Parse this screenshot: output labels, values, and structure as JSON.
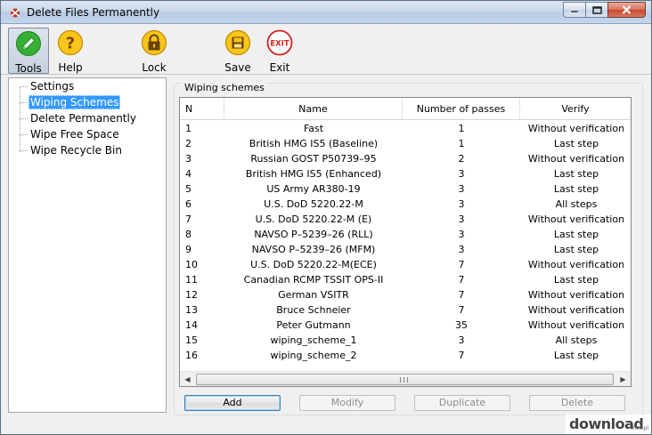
{
  "window": {
    "title": "Delete Files Permanently"
  },
  "toolbar": {
    "tools_label": "Tools",
    "help_label": "Help",
    "lock_label": "Lock",
    "save_label": "Save",
    "exit_label": "Exit",
    "exit_icon_text": "EXIT"
  },
  "sidebar": {
    "items": [
      {
        "label": "Settings"
      },
      {
        "label": "Wiping Schemes",
        "selected": true
      },
      {
        "label": "Delete Permanently"
      },
      {
        "label": "Wipe Free Space"
      },
      {
        "label": "Wipe Recycle Bin"
      }
    ]
  },
  "schemes": {
    "group_title": "Wiping schemes",
    "columns": [
      "N",
      "Name",
      "Number of passes",
      "Verify"
    ],
    "rows": [
      {
        "n": "1",
        "name": "Fast",
        "passes": "1",
        "verify": "Without verification"
      },
      {
        "n": "2",
        "name": "British HMG IS5 (Baseline)",
        "passes": "1",
        "verify": "Last step"
      },
      {
        "n": "3",
        "name": "Russian GOST P50739–95",
        "passes": "2",
        "verify": "Without verification"
      },
      {
        "n": "4",
        "name": "British HMG IS5 (Enhanced)",
        "passes": "3",
        "verify": "Last step"
      },
      {
        "n": "5",
        "name": "US Army AR380-19",
        "passes": "3",
        "verify": "Last step"
      },
      {
        "n": "6",
        "name": "U.S. DoD 5220.22-M",
        "passes": "3",
        "verify": "All steps"
      },
      {
        "n": "7",
        "name": "U.S. DoD 5220.22-M (E)",
        "passes": "3",
        "verify": "Without verification"
      },
      {
        "n": "8",
        "name": "NAVSO P–5239–26 (RLL)",
        "passes": "3",
        "verify": "Last step"
      },
      {
        "n": "9",
        "name": "NAVSO P–5239–26 (MFM)",
        "passes": "3",
        "verify": "Last step"
      },
      {
        "n": "10",
        "name": "U.S. DoD 5220.22-M(ECE)",
        "passes": "7",
        "verify": "Without verification"
      },
      {
        "n": "11",
        "name": "Canadian RCMP TSSIT OPS-II",
        "passes": "7",
        "verify": "Last step"
      },
      {
        "n": "12",
        "name": "German VSITR",
        "passes": "7",
        "verify": "Without verification"
      },
      {
        "n": "13",
        "name": "Bruce Schneier",
        "passes": "7",
        "verify": "Without verification"
      },
      {
        "n": "14",
        "name": "Peter Gutmann",
        "passes": "35",
        "verify": "Without verification"
      },
      {
        "n": "15",
        "name": "wiping_scheme_1",
        "passes": "3",
        "verify": "All steps"
      },
      {
        "n": "16",
        "name": "wiping_scheme_2",
        "passes": "7",
        "verify": "Last step"
      }
    ]
  },
  "buttons": {
    "add": "Add",
    "modify": "Modify",
    "duplicate": "Duplicate",
    "delete": "Delete"
  },
  "watermark": {
    "text": "download",
    "small": ".net.pl"
  },
  "colors": {
    "selection": "#3399ff",
    "exit_red": "#d12020",
    "help_yellow": "#f5b400",
    "tools_green": "#2fa12f"
  }
}
